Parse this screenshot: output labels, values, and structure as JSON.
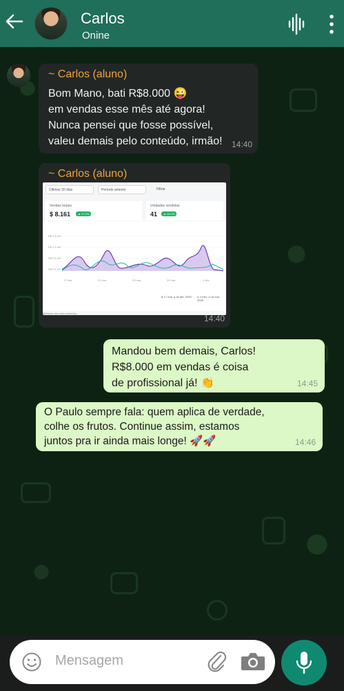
{
  "header": {
    "contact_name": "Carlos",
    "status": "Onine"
  },
  "messages": [
    {
      "direction": "incoming",
      "sender": "~ Carlos (aluno)",
      "text": "Bom Mano, bati R$8.000 😜\nem vendas esse mês até agora!\nNunca pensei que fosse possível,\nvaleu demais pelo conteúdo, irmão!",
      "time": "14:40"
    },
    {
      "direction": "incoming",
      "sender": "~ Carlos (aluno)",
      "type": "image",
      "time": "14:40",
      "image": {
        "period_select": "Últimos 30 dias",
        "compare_select": "Período anterior",
        "filter_label": "Filtrar",
        "sales_label": "Vendas brutas",
        "sales_value": "$ 8.161",
        "sales_badge": "▲ 17.2%",
        "units_label": "Unidades vendidas",
        "units_value": "41",
        "units_badge": "▲ 24.2%",
        "y_ticks": [
          "R$ 1,5 mil",
          "R$ 1,0 mil",
          "R$ 0,5 mil",
          "R$ 0,0 mil"
        ],
        "x_ticks": [
          "17 mar.",
          "21 mar.",
          "25 mar.",
          "29 mar.",
          "2 abr."
        ],
        "legend_a": "17 mar. a 16 abr. 2025",
        "legend_b": "14 fev. a 16 mar. 2025",
        "footer": "Métricas dos seus anúncios"
      }
    },
    {
      "direction": "outgoing",
      "text": "Mandou bem demais, Carlos!\nR$8.000 em vendas é coisa\nde profissional já! 👏",
      "time": "14:45"
    },
    {
      "direction": "outgoing",
      "text": "O Paulo sempre fala: quem aplica de verdade,\ncolhe os frutos. Continue assim, estamos\njuntos pra ir ainda mais longe! 🚀🚀",
      "time": "14:46"
    }
  ],
  "composer": {
    "placeholder": "Mensagem"
  },
  "colors": {
    "header": "#1f6f5b",
    "outgoing_bubble": "#dcf8c6",
    "incoming_bubble": "#222725",
    "sender_name": "#f0a33a",
    "mic_button": "#0f8a70"
  },
  "icons": [
    "back-arrow-icon",
    "voice-wave-icon",
    "more-vert-icon",
    "emoji-icon",
    "attach-clip-icon",
    "camera-icon",
    "mic-icon"
  ]
}
